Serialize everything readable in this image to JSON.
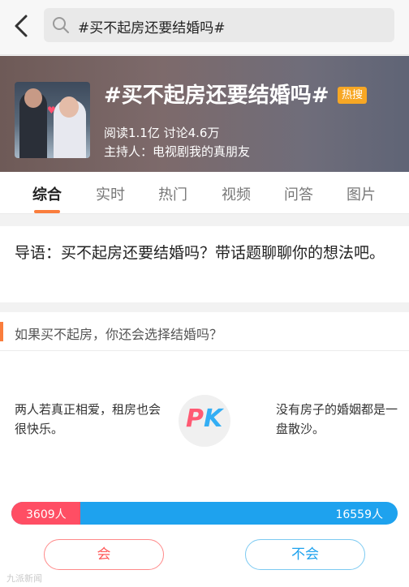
{
  "header": {
    "search_text": "#买不起房还要结婚吗#",
    "icons": {
      "back": "chevron-left-icon",
      "search": "search-icon"
    }
  },
  "banner": {
    "title": "#买不起房还要结婚吗#",
    "hot_badge": "热搜",
    "stats": "阅读1.1亿  讨论4.6万",
    "host": "主持人：电视剧我的真朋友"
  },
  "tabs": [
    "综合",
    "实时",
    "热门",
    "视频",
    "问答",
    "图片"
  ],
  "active_tab": "综合",
  "intro": {
    "text": "导语：买不起房还要结婚吗？带话题聊聊你的想法吧。"
  },
  "poll": {
    "question": "如果买不起房，你还会选择结婚吗？",
    "left_opinion": "两人若真正相爱，租房也会很快乐。",
    "right_opinion": "没有房子的婚姻都是一盘散沙。",
    "pk_p": "P",
    "pk_k": "K",
    "yes_count": 3609,
    "no_count": 16559,
    "yes_label": "3609人",
    "no_label": "16559人",
    "yes_button": "会",
    "no_button": "不会",
    "colors": {
      "yes": "#ff4e64",
      "no": "#1ea2ee",
      "accent": "#fa7d3c"
    }
  },
  "watermark": "九派新闻"
}
